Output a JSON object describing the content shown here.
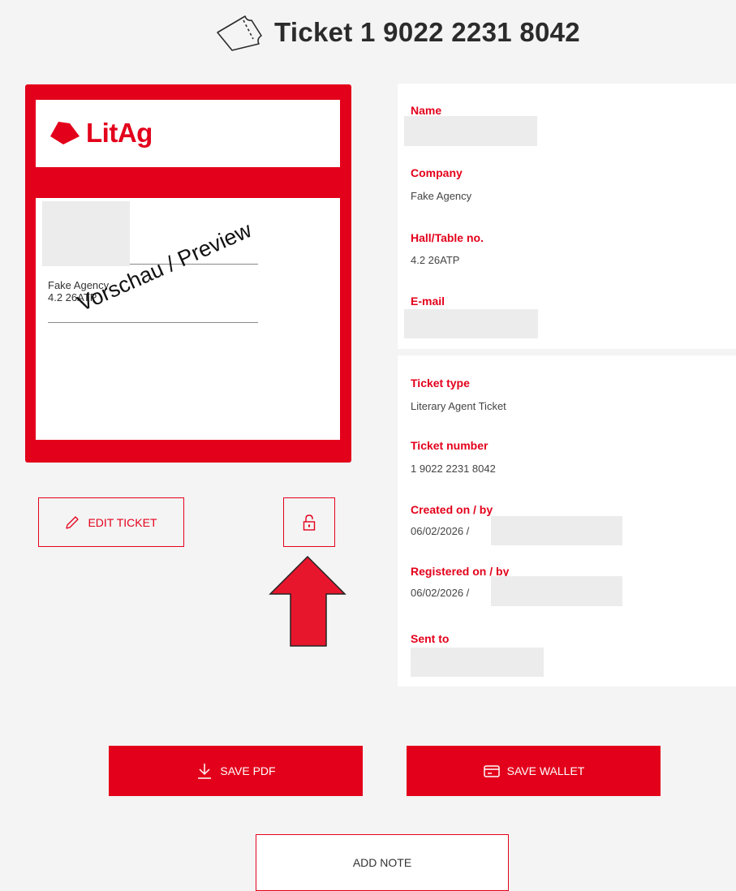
{
  "header": {
    "title": "Ticket 1 9022 2231 8042",
    "icon": "ticket-icon"
  },
  "card": {
    "logo_text": "LitAg",
    "company": "Fake Agency",
    "hall": "4.2 26ATP",
    "watermark": "Vorschau / Preview",
    "colors": {
      "accent": "#e3001b"
    }
  },
  "actions": {
    "edit_label": "EDIT TICKET",
    "save_pdf_label": "SAVE PDF",
    "save_wallet_label": "SAVE WALLET",
    "add_note_label": "ADD NOTE"
  },
  "details": {
    "name_label": "Name",
    "company_label": "Company",
    "company_value": "Fake Agency",
    "hall_label": "Hall/Table no.",
    "hall_value": "4.2 26ATP",
    "email_label": "E-mail",
    "ticket_type_label": "Ticket type",
    "ticket_type_value": "Literary Agent Ticket",
    "ticket_number_label": "Ticket number",
    "ticket_number_value": "1 9022 2231 8042",
    "created_label": "Created on / by",
    "created_value": "06/02/2026 /",
    "registered_label": "Registered on / by",
    "registered_value": "06/02/2026 /",
    "sent_to_label": "Sent to"
  }
}
